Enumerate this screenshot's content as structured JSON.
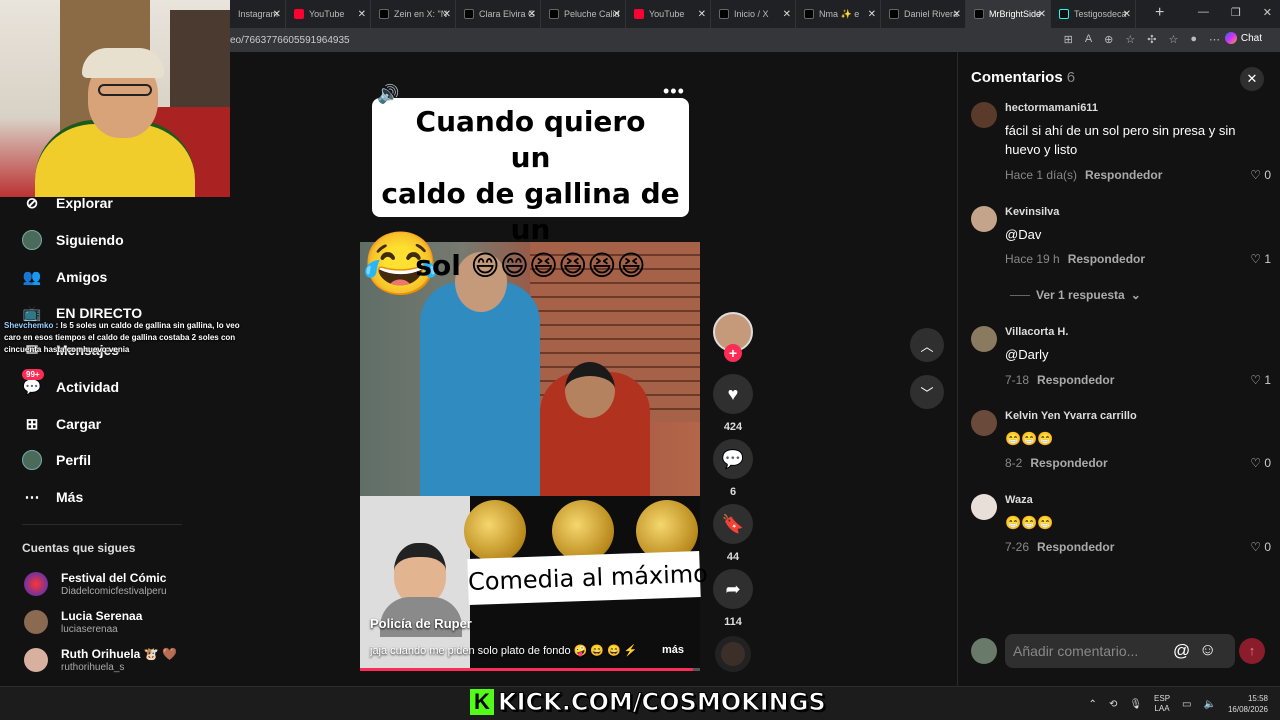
{
  "browser": {
    "tabs": [
      {
        "label": "Instagram",
        "icon": "instagram-icon",
        "active": false
      },
      {
        "label": "YouTube",
        "icon": "youtube-icon",
        "active": false
      },
      {
        "label": "Zein en X: \"N",
        "icon": "x-icon",
        "active": false
      },
      {
        "label": "Clara Elvira G",
        "icon": "x-icon",
        "active": false
      },
      {
        "label": "Peluche Calid",
        "icon": "x-icon",
        "active": false
      },
      {
        "label": "YouTube",
        "icon": "youtube-icon",
        "active": false
      },
      {
        "label": "Inicio / X",
        "icon": "x-icon",
        "active": false
      },
      {
        "label": "Nma ✨ e",
        "icon": "x-icon",
        "active": false
      },
      {
        "label": "Daniel Rivera",
        "icon": "x-icon",
        "active": false
      },
      {
        "label": "MrBrightSide",
        "icon": "x-icon",
        "active": true
      },
      {
        "label": "Testigosdeca",
        "icon": "tiktok-icon",
        "active": false
      }
    ],
    "new_tab": "+",
    "url": "eo/7663776605591964935",
    "chat_label": "Chat"
  },
  "sidebar": {
    "items": [
      {
        "label": "Explorar",
        "icon": "compass-icon"
      },
      {
        "label": "Siguiendo",
        "icon": "following-avatar-icon"
      },
      {
        "label": "Amigos",
        "icon": "friends-icon"
      },
      {
        "label": "EN DIRECTO",
        "icon": "live-icon"
      },
      {
        "label": "Mensajes",
        "icon": "messages-icon"
      },
      {
        "label": "Actividad",
        "icon": "activity-icon",
        "badge": "99+"
      },
      {
        "label": "Cargar",
        "icon": "upload-icon"
      },
      {
        "label": "Perfil",
        "icon": "profile-icon"
      },
      {
        "label": "Más",
        "icon": "more-icon"
      }
    ],
    "following_title": "Cuentas que sigues",
    "following": [
      {
        "name": "Festival del Cómic",
        "handle": "Diadelcomicfestivalperu"
      },
      {
        "name": "Lucia Serenaa",
        "handle": "luciaserenaa"
      },
      {
        "name": "Ruth Orihuela 🐮 🤎",
        "handle": "ruthorihuela_s"
      }
    ]
  },
  "stream_chat": {
    "user": "Shevchemko",
    "message": " : Is 5 soles un caldo de gallina sin gallina, lo veo caro en esos tiempos el caldo de gallina costaba 2 soles con cincuenta hasta con huevo venia"
  },
  "video": {
    "caption_line1": "Cuando quiero un",
    "caption_line2": "caldo de gallina de un",
    "caption_line3": "sol 😄😄😆😆😆😆",
    "laugh_emoji": "😂",
    "promo_text": "Comedia al máximo",
    "author": "Policía de Ruper",
    "description": "jaja cuando me piden solo plato de fondo 🤪 😄 😄 ⚡",
    "more": "más",
    "progress": 0.98
  },
  "actions": {
    "likes": "424",
    "comments": "6",
    "saves": "44",
    "shares": "114"
  },
  "comments_panel": {
    "title": "Comentarios",
    "count": "6",
    "comments": [
      {
        "user": "hectormamani611",
        "text": "fácil si ahí de un sol pero sin presa y sin huevo y listo",
        "time": "Hace 1 día(s)",
        "reply": "Respondedor",
        "likes": "0"
      },
      {
        "user": "Kevinsilva",
        "text": "@Dav",
        "time": "Hace 19 h",
        "reply": "Respondedor",
        "likes": "1"
      },
      {
        "user": "Villacorta H.",
        "text": "@Darly",
        "time": "7-18",
        "reply": "Respondedor",
        "likes": "1"
      },
      {
        "user": "Kelvin Yen Yvarra carrillo",
        "text": "😁😁😁",
        "time": "8-2",
        "reply": "Respondedor",
        "likes": "0"
      },
      {
        "user": "Waza",
        "text": "😁😁😁",
        "time": "7-26",
        "reply": "Respondedor",
        "likes": "0"
      }
    ],
    "view_replies": "Ver 1 respuesta",
    "input_placeholder": "Añadir comentario..."
  },
  "taskbar": {
    "kick_text": "KICK.COM/COSMOKINGS",
    "lang_line1": "ESP",
    "lang_line2": "LAA",
    "time": "15:58",
    "date": "16/08/2026"
  },
  "colors": {
    "accent": "#fe2c55",
    "kick_green": "#53fc18",
    "background": "#121212"
  }
}
